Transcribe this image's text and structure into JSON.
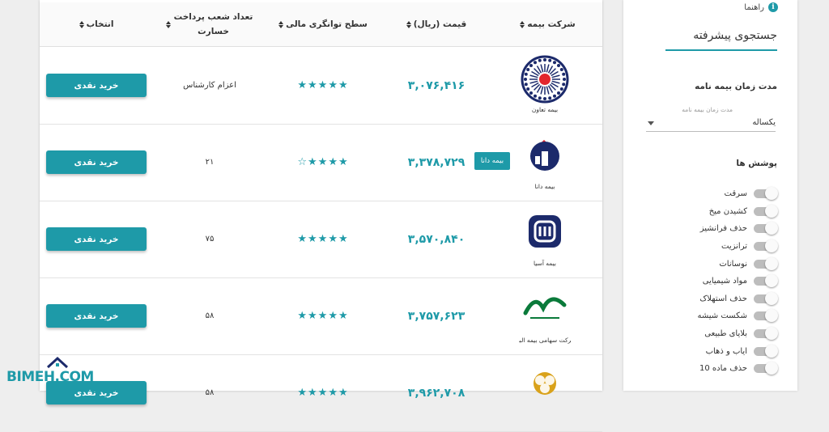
{
  "sidebar": {
    "help_label": "راهنما",
    "help_icon": "info-icon",
    "title": "جستجوی پیشرفته",
    "duration_section": "مدت زمان بیمه نامه",
    "duration_field_label": "مدت زمان بیمه نامه",
    "duration_value": "یکساله",
    "coverage_section": "پوشش ها",
    "coverages": [
      {
        "label": "سرقت",
        "on": false
      },
      {
        "label": "کشیدن میخ",
        "on": false
      },
      {
        "label": "حذف فرانشیز",
        "on": false
      },
      {
        "label": "ترانزیت",
        "on": false
      },
      {
        "label": "نوسانات",
        "on": false
      },
      {
        "label": "مواد شیمیایی",
        "on": false
      },
      {
        "label": "حذف استهلاک",
        "on": false
      },
      {
        "label": "شکست شیشه",
        "on": false
      },
      {
        "label": "بلایای طبیعی",
        "on": false
      },
      {
        "label": "ایاب و ذهاب",
        "on": false
      },
      {
        "label": "حذف ماده 10",
        "on": false
      }
    ]
  },
  "table": {
    "headers": {
      "company": "شرکت بیمه",
      "price": "قیمت (ریال)",
      "rating": "سطح توانگری مالی",
      "branches": "تعداد شعب پرداخت خسارت",
      "select": "انتخاب"
    },
    "buy_label": "خرید نقدی",
    "rows": [
      {
        "logo_caption": "بیمه تعاون",
        "price": "۳,۰۷۶,۴۱۶",
        "stars": 5,
        "branches": "اعزام کارشناس",
        "badge": ""
      },
      {
        "logo_caption": "بیمه دانا",
        "price": "۳,۳۷۸,۷۲۹",
        "stars": 4,
        "branches": "۲۱",
        "badge": "بیمه دانا"
      },
      {
        "logo_caption": "بیمه آسیا",
        "price": "۳,۵۷۰,۸۴۰",
        "stars": 5,
        "branches": "۷۵",
        "badge": ""
      },
      {
        "logo_caption": "شرکت سهامی بیمه البرز",
        "price": "۳,۷۵۷,۶۲۳",
        "stars": 5,
        "branches": "۵۸",
        "badge": ""
      },
      {
        "logo_caption": "",
        "price": "۳,۹۶۲,۷۰۸",
        "stars": 5,
        "branches": "۵۸",
        "badge": ""
      }
    ]
  },
  "watermark": "BIMEH.COM",
  "colors": {
    "accent": "#1e9aa8",
    "logo_red": "#e3262d",
    "logo_navy": "#1c2a6b"
  }
}
